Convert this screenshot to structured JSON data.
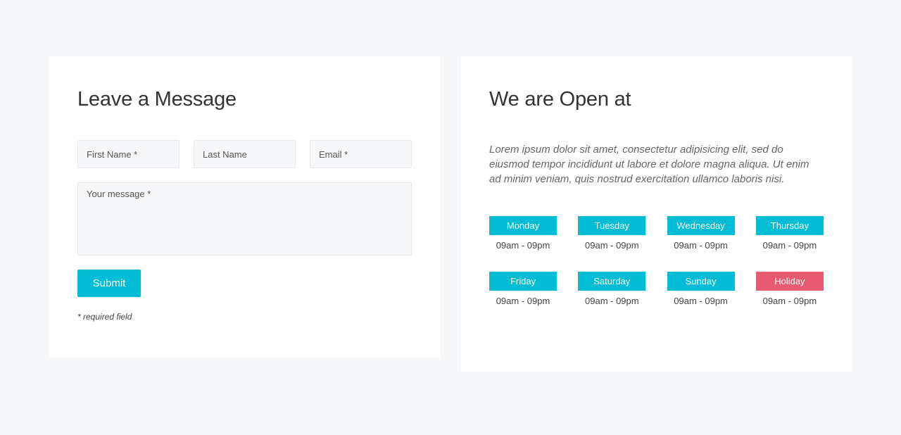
{
  "message_form": {
    "title": "Leave a Message",
    "first_name_placeholder": "First Name *",
    "last_name_placeholder": "Last Name",
    "email_placeholder": "Email *",
    "message_placeholder": "Your message *",
    "submit_label": "Submit",
    "required_note": "* required field"
  },
  "opening_hours": {
    "title": "We are Open at",
    "intro": "Lorem ipsum dolor sit amet, consectetur adipisicing elit, sed do eiusmod tempor incididunt ut labore et dolore magna aliqua. Ut enim ad minim veniam, quis nostrud exercitation ullamco laboris nisi.",
    "days": [
      {
        "day": "Monday",
        "time": "09am - 09pm"
      },
      {
        "day": "Tuesday",
        "time": "09am - 09pm"
      },
      {
        "day": "Wednesday",
        "time": "09am - 09pm"
      },
      {
        "day": "Thursday",
        "time": "09am - 09pm"
      },
      {
        "day": "Friday",
        "time": "09am - 09pm"
      },
      {
        "day": "Saturday",
        "time": "09am - 09pm"
      },
      {
        "day": "Sunday",
        "time": "09am - 09pm"
      },
      {
        "day": "Holiday",
        "time": "09am - 09pm"
      }
    ]
  },
  "colors": {
    "accent": "#00bcd4",
    "holiday": "#e75a72",
    "page_background": "#f6f7f9",
    "card_background": "#ffffff"
  }
}
